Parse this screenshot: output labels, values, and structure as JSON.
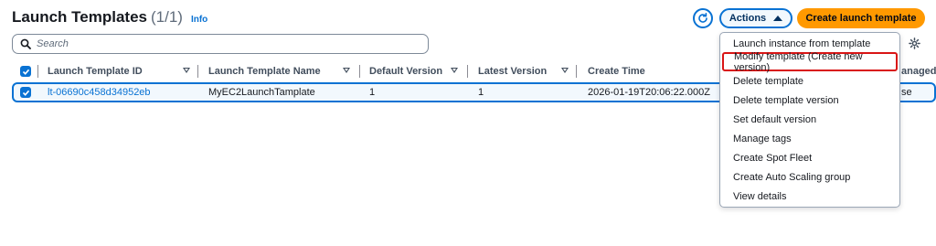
{
  "header": {
    "title": "Launch Templates",
    "count": "(1/1)",
    "info": "Info"
  },
  "toolbar": {
    "actions_label": "Actions",
    "create_label": "Create launch template"
  },
  "search": {
    "placeholder": "Search"
  },
  "table": {
    "columns": [
      "Launch Template ID",
      "Launch Template Name",
      "Default Version",
      "Latest Version",
      "Create Time",
      "anaged"
    ],
    "rows": [
      {
        "id": "lt-06690c458d34952eb",
        "name": "MyEC2LaunchTamplate",
        "default_version": "1",
        "latest_version": "1",
        "create_time": "2026-01-19T20:06:22.000Z",
        "managed": "se"
      }
    ]
  },
  "actions_menu": {
    "items": [
      "Launch instance from template",
      "Modify template (Create new version)",
      "Delete template",
      "Delete template version",
      "Set default version",
      "Manage tags",
      "Create Spot Fleet",
      "Create Auto Scaling group",
      "View details"
    ],
    "highlighted_index": 1
  },
  "colors": {
    "accent": "#0972d3",
    "primary_button": "#ff9900",
    "highlight_border": "#d91515",
    "selected_row_bg": "#f2f8fd"
  }
}
